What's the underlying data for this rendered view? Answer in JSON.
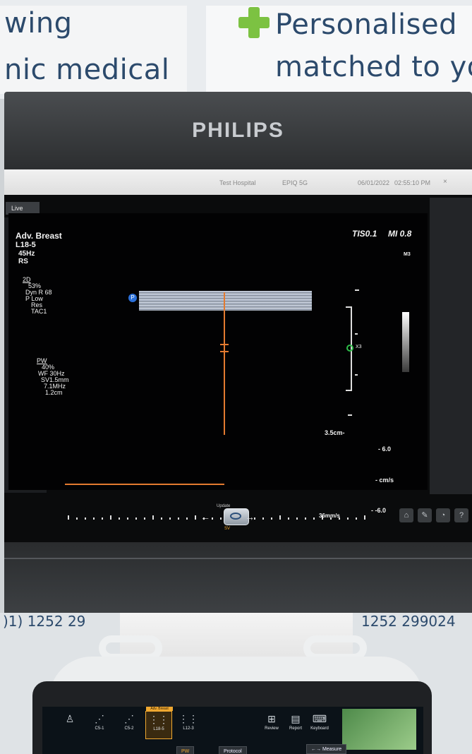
{
  "banner": {
    "left_line1": "wing",
    "left_line2": "nic medical",
    "right_line1": "Personalised",
    "right_line2": "matched to yo"
  },
  "monitor": {
    "brand": "PHILIPS",
    "titlebar": {
      "hospital": "Test Hospital",
      "system": "EPIQ 5G",
      "date": "06/01/2022",
      "time": "02:55:10 PM",
      "close": "×"
    },
    "tab": "Live",
    "preset": "Adv. Breast",
    "transducer": "L18-5",
    "frame_rate": "45Hz",
    "mode_rs": "RS",
    "twod": {
      "label": "2D",
      "gain": "53%",
      "dyn_range": "Dyn R 68",
      "power": "P Low",
      "res": "Res",
      "tac": "TAC1"
    },
    "pw": {
      "label": "PW",
      "gain": "40%",
      "wall_filter": "WF 30Hz",
      "sample_volume": "SV1.5mm",
      "frequency": "7.1MHz",
      "depth": "1.2cm"
    },
    "tis": "TIS0.1",
    "mi": "MI 0.8",
    "map": "M3",
    "focus_label": "X3",
    "depth_readout": "3.5cm-",
    "velocity_top": "- 6.0",
    "velocity_unit": "- cm/s",
    "velocity_bottom": "- -6.0",
    "sweep_speed": "36mm/s",
    "update": {
      "label": "Update",
      "sub": "SV",
      "left_arrow": "←",
      "right_arrow": "→"
    },
    "tool_icons": [
      "camera-icon",
      "wrench-icon",
      "speaker-icon",
      "help-icon"
    ]
  },
  "lower": {
    "phone_left": ")1) 1252 29",
    "phone_right": "1252 299024"
  },
  "touchscreen": {
    "transducers": [
      {
        "name": "",
        "icon": "person-icon"
      },
      {
        "name": "C5-1",
        "icon": "curved-probe-icon"
      },
      {
        "name": "C5-2",
        "icon": "curved-probe-icon"
      },
      {
        "name": "L18-5",
        "icon": "linear-probe-icon",
        "active_label": "Adv. Breast"
      },
      {
        "name": "L12-3",
        "icon": "linear-probe-icon"
      },
      {
        "name": "",
        "icon": "blank"
      }
    ],
    "review": "Review",
    "report": "Report",
    "keyboard": "Keyboard",
    "pw_button": "PW",
    "protocol_button": "Protocol",
    "measure_button": "←→ Measure"
  }
}
